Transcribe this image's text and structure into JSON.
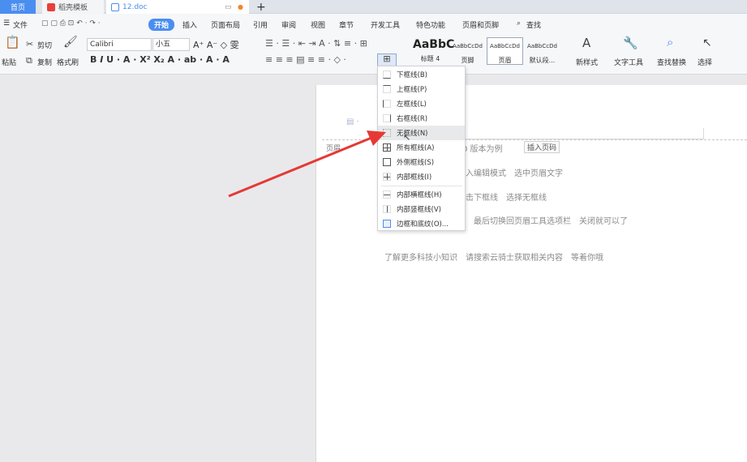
{
  "tabs": {
    "home": "首页",
    "template": "稻壳模板",
    "doc": "12.doc",
    "new_tab": "+"
  },
  "menubar": {
    "file": "文件",
    "items": [
      "开始",
      "插入",
      "页面布局",
      "引用",
      "审阅",
      "视图",
      "章节",
      "开发工具",
      "特色功能",
      "页眉和页脚"
    ],
    "search": "查找"
  },
  "ribbon": {
    "paste": "粘贴",
    "cut": "剪切",
    "copy": "复制",
    "format_painter": "格式刷",
    "font_name": "Calibri",
    "font_size": "小五",
    "styles": [
      {
        "preview": "AaBbC",
        "name": "标题 4"
      },
      {
        "preview": "AaBbCcDd",
        "name": "页脚"
      },
      {
        "preview": "AaBbCcDd",
        "name": "页眉"
      },
      {
        "preview": "AaBbCcDd",
        "name": "默认段..."
      }
    ],
    "new_style": "新样式",
    "text_tools": "文字工具",
    "find_replace": "查找替换",
    "select": "选择"
  },
  "document": {
    "header_label": "页眉",
    "insert_page_number": "插入页码",
    "lines": [
      "0 版本为例",
      "入编辑模式　选中页眉文字",
      "击下框线　选择无框线",
      "最后切换回页眉工具选项栏　关闭就可以了",
      "了解更多科技小知识　请搜索云骑士获取相关内容　等着你哦"
    ]
  },
  "border_menu": {
    "items": [
      "下框线(B)",
      "上框线(P)",
      "左框线(L)",
      "右框线(R)",
      "无框线(N)",
      "所有框线(A)",
      "外侧框线(S)",
      "内部框线(I)",
      "内部横框线(H)",
      "内部竖框线(V)",
      "边框和底纹(O)..."
    ],
    "highlighted": "无框线(N)"
  },
  "colors": {
    "accent": "#4a8ef0",
    "arrow": "#e53935"
  }
}
